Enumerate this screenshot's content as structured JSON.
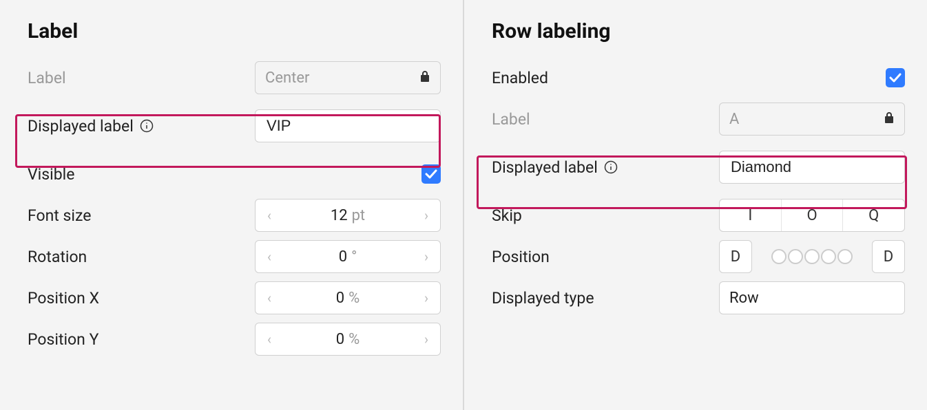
{
  "left": {
    "title": "Label",
    "label_field_label": "Label",
    "label_field_value": "Center",
    "displayed_label_label": "Displayed label",
    "displayed_label_value": "VIP",
    "visible_label": "Visible",
    "visible_checked": true,
    "font_size_label": "Font size",
    "font_size_value": "12",
    "font_size_unit": "pt",
    "rotation_label": "Rotation",
    "rotation_value": "0",
    "rotation_unit": "°",
    "posx_label": "Position X",
    "posx_value": "0",
    "posx_unit": "%",
    "posy_label": "Position Y",
    "posy_value": "0",
    "posy_unit": "%"
  },
  "right": {
    "title": "Row labeling",
    "enabled_label": "Enabled",
    "enabled_checked": true,
    "label_field_label": "Label",
    "label_field_value": "A",
    "displayed_label_label": "Displayed label",
    "displayed_label_value": "Diamond",
    "skip_label": "Skip",
    "skip_options": [
      "I",
      "O",
      "Q"
    ],
    "position_label": "Position",
    "position_left": "D",
    "position_right": "D",
    "displayed_type_label": "Displayed type",
    "displayed_type_value": "Row"
  }
}
